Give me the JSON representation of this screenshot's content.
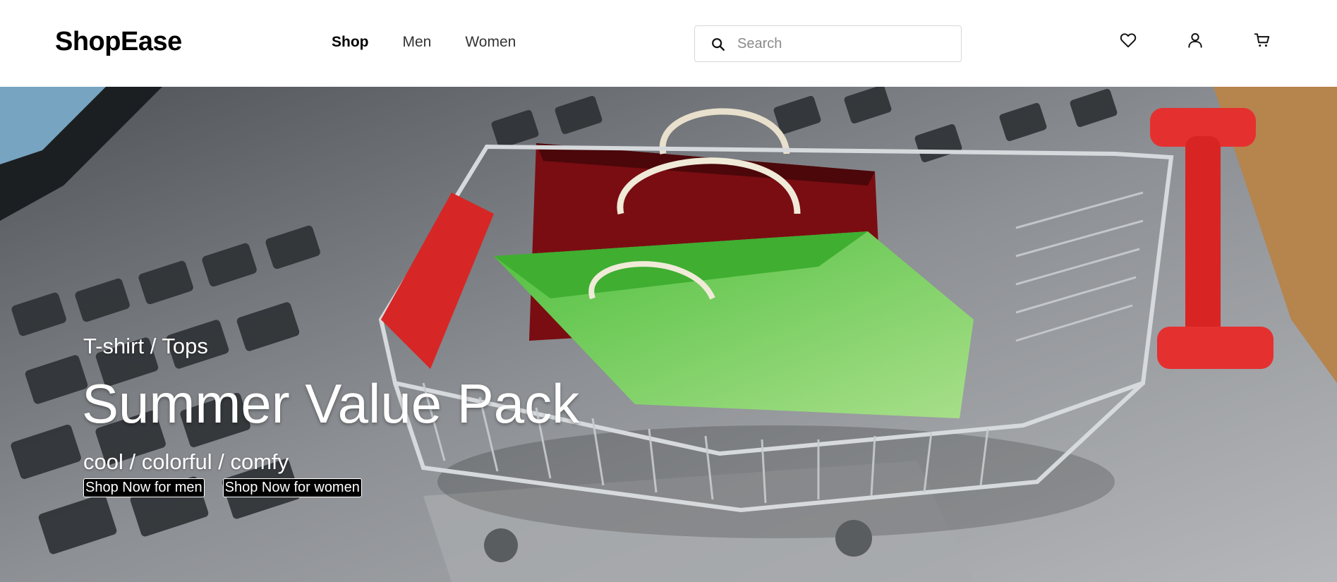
{
  "header": {
    "logo": "ShopEase",
    "nav": [
      {
        "label": "Shop",
        "active": true
      },
      {
        "label": "Men",
        "active": false
      },
      {
        "label": "Women",
        "active": false
      }
    ],
    "search": {
      "placeholder": "Search",
      "value": ""
    },
    "icons": [
      "heart-icon",
      "user-icon",
      "cart-icon"
    ]
  },
  "hero": {
    "category": "T-shirt / Tops",
    "headline": "Summer Value Pack",
    "tagline": "cool / colorful / comfy",
    "buttons": [
      {
        "label": "Shop Now for men"
      },
      {
        "label": "Shop Now for women"
      }
    ]
  },
  "colors": {
    "text": "#000000",
    "nav_muted": "#333333",
    "button_bg": "#000000",
    "button_text": "#ffffff"
  }
}
